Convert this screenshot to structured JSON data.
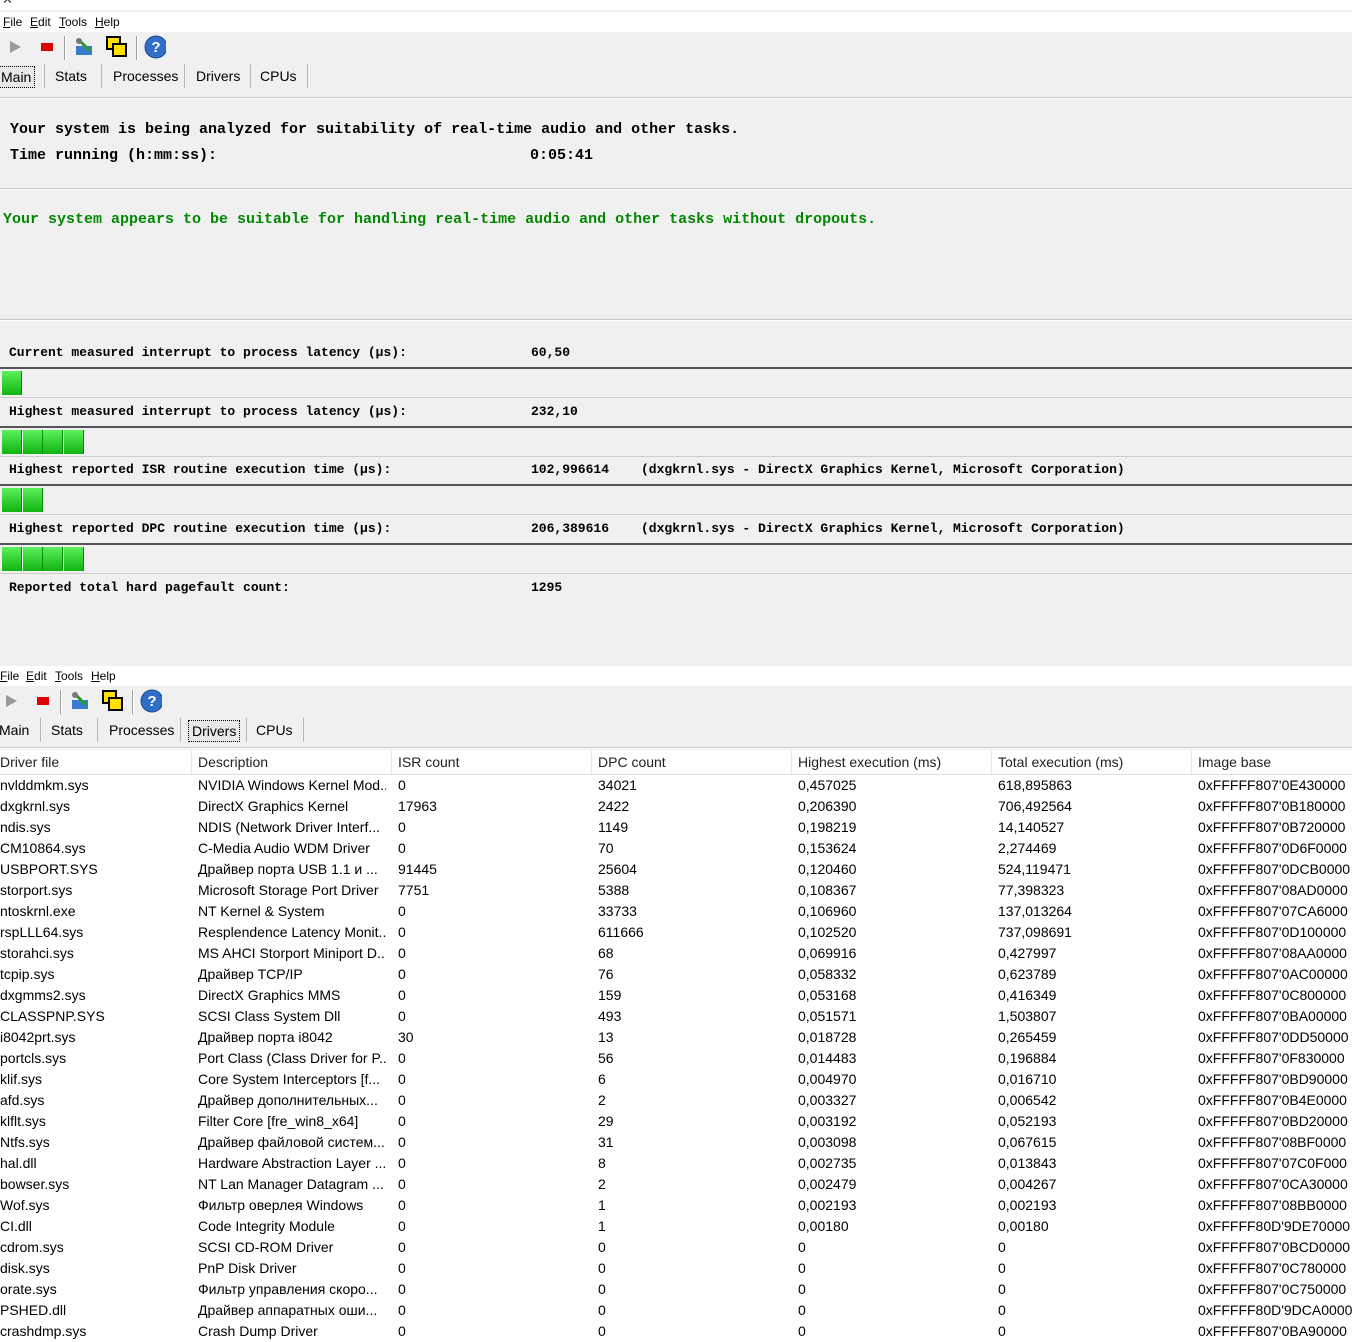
{
  "window": {
    "close_label": "✕"
  },
  "menu": [
    "File",
    "Edit",
    "Tools",
    "Help"
  ],
  "tabs": [
    "Main",
    "Stats",
    "Processes",
    "Drivers",
    "CPUs"
  ],
  "toolbar_icons": [
    "play-icon",
    "stop-icon",
    "options-icon",
    "windows-icon",
    "help-icon"
  ],
  "main": {
    "line1": "Your system is being analyzed for suitability of real-time audio and other tasks.",
    "time_label": "Time running (h:mm:ss):",
    "time_value": "0:05:41",
    "verdict": "Your system appears to be suitable for handling real-time audio and other tasks without dropouts.",
    "verdict_color": "#008800",
    "measurements": [
      {
        "label": "Current measured interrupt to process latency (µs):",
        "value": "60,50",
        "extra": "",
        "segments": 1
      },
      {
        "label": "Highest measured interrupt to process latency (µs):",
        "value": "232,10",
        "extra": "",
        "segments": 4
      },
      {
        "label": "Highest reported ISR routine execution time (µs):",
        "value": "102,996614",
        "extra": "(dxgkrnl.sys - DirectX Graphics Kernel, Microsoft Corporation)",
        "segments": 2
      },
      {
        "label": "Highest reported DPC routine execution time (µs):",
        "value": "206,389616",
        "extra": "(dxgkrnl.sys - DirectX Graphics Kernel, Microsoft Corporation)",
        "segments": 4
      },
      {
        "label": "Reported total hard pagefault count:",
        "value": "1295",
        "extra": "",
        "segments": 0
      }
    ]
  },
  "drivers": {
    "columns": [
      "Driver file",
      "Description",
      "ISR count",
      "DPC count",
      "Highest execution (ms)",
      "Total execution (ms)",
      "Image base"
    ],
    "rows": [
      [
        "nvlddmkm.sys",
        "NVIDIA Windows Kernel Mod...",
        "0",
        "34021",
        "0,457025",
        "618,895863",
        "0xFFFFF807'0E430000"
      ],
      [
        "dxgkrnl.sys",
        "DirectX Graphics Kernel",
        "17963",
        "2422",
        "0,206390",
        "706,492564",
        "0xFFFFF807'0B180000"
      ],
      [
        "ndis.sys",
        "NDIS (Network Driver Interf...",
        "0",
        "1149",
        "0,198219",
        "14,140527",
        "0xFFFFF807'0B720000"
      ],
      [
        "CM10864.sys",
        "C-Media Audio WDM Driver",
        "0",
        "70",
        "0,153624",
        "2,274469",
        "0xFFFFF807'0D6F0000"
      ],
      [
        "USBPORT.SYS",
        "Драйвер порта USB 1.1 и ...",
        "91445",
        "25604",
        "0,120460",
        "524,119471",
        "0xFFFFF807'0DCB0000"
      ],
      [
        "storport.sys",
        "Microsoft Storage Port Driver",
        "7751",
        "5388",
        "0,108367",
        "77,398323",
        "0xFFFFF807'08AD0000"
      ],
      [
        "ntoskrnl.exe",
        "NT Kernel & System",
        "0",
        "33733",
        "0,106960",
        "137,013264",
        "0xFFFFF807'07CA6000"
      ],
      [
        "rspLLL64.sys",
        "Resplendence Latency Monit...",
        "0",
        "611666",
        "0,102520",
        "737,098691",
        "0xFFFFF807'0D100000"
      ],
      [
        "storahci.sys",
        "MS AHCI Storport Miniport D...",
        "0",
        "68",
        "0,069916",
        "0,427997",
        "0xFFFFF807'08AA0000"
      ],
      [
        "tcpip.sys",
        "Драйвер TCP/IP",
        "0",
        "76",
        "0,058332",
        "0,623789",
        "0xFFFFF807'0AC00000"
      ],
      [
        "dxgmms2.sys",
        "DirectX Graphics MMS",
        "0",
        "159",
        "0,053168",
        "0,416349",
        "0xFFFFF807'0C800000"
      ],
      [
        "CLASSPNP.SYS",
        "SCSI Class System Dll",
        "0",
        "493",
        "0,051571",
        "1,503807",
        "0xFFFFF807'0BA00000"
      ],
      [
        "i8042prt.sys",
        "Драйвер порта i8042",
        "30",
        "13",
        "0,018728",
        "0,265459",
        "0xFFFFF807'0DD50000"
      ],
      [
        "portcls.sys",
        "Port Class (Class Driver for P...",
        "0",
        "56",
        "0,014483",
        "0,196884",
        "0xFFFFF807'0F830000"
      ],
      [
        "klif.sys",
        "Core System Interceptors [f...",
        "0",
        "6",
        "0,004970",
        "0,016710",
        "0xFFFFF807'0BD90000"
      ],
      [
        "afd.sys",
        "Драйвер дополнительных...",
        "0",
        "2",
        "0,003327",
        "0,006542",
        "0xFFFFF807'0B4E0000"
      ],
      [
        "klflt.sys",
        "Filter Core [fre_win8_x64]",
        "0",
        "29",
        "0,003192",
        "0,052193",
        "0xFFFFF807'0BD20000"
      ],
      [
        "Ntfs.sys",
        "Драйвер файловой систем...",
        "0",
        "31",
        "0,003098",
        "0,067615",
        "0xFFFFF807'08BF0000"
      ],
      [
        "hal.dll",
        "Hardware Abstraction Layer ...",
        "0",
        "8",
        "0,002735",
        "0,013843",
        "0xFFFFF807'07C0F000"
      ],
      [
        "bowser.sys",
        "NT Lan Manager Datagram ...",
        "0",
        "2",
        "0,002479",
        "0,004267",
        "0xFFFFF807'0CA30000"
      ],
      [
        "Wof.sys",
        "Фильтр оверлея Windows",
        "0",
        "1",
        "0,002193",
        "0,002193",
        "0xFFFFF807'08BB0000"
      ],
      [
        "CI.dll",
        "Code Integrity Module",
        "0",
        "1",
        "0,00180",
        "0,00180",
        "0xFFFFF80D'9DE70000"
      ],
      [
        "cdrom.sys",
        "SCSI CD-ROM Driver",
        "0",
        "0",
        "0",
        "0",
        "0xFFFFF807'0BCD0000"
      ],
      [
        "disk.sys",
        "PnP Disk Driver",
        "0",
        "0",
        "0",
        "0",
        "0xFFFFF807'0C780000"
      ],
      [
        "orate.sys",
        "Фильтр управления скоро...",
        "0",
        "0",
        "0",
        "0",
        "0xFFFFF807'0C750000"
      ],
      [
        "PSHED.dll",
        "Драйвер аппаратных оши...",
        "0",
        "0",
        "0",
        "0",
        "0xFFFFF80D'9DCA0000"
      ],
      [
        "crashdmp.sys",
        "Crash Dump Driver",
        "0",
        "0",
        "0",
        "0",
        "0xFFFFF807'0BA90000"
      ]
    ]
  }
}
